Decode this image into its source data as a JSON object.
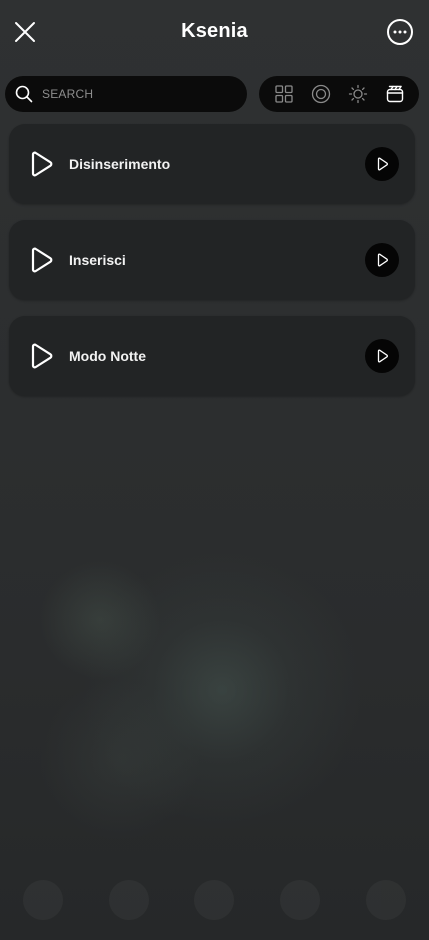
{
  "header": {
    "title": "Ksenia",
    "close_icon": "close-icon",
    "more_icon": "more-horizontal-icon"
  },
  "search": {
    "placeholder": "SEARCH",
    "value": "",
    "icon": "search-icon"
  },
  "filters": [
    {
      "name": "grid-filter",
      "icon": "grid-icon"
    },
    {
      "name": "target-filter",
      "icon": "target-icon"
    },
    {
      "name": "light-filter",
      "icon": "sun-icon"
    },
    {
      "name": "scenario-filter",
      "icon": "clapperboard-icon"
    }
  ],
  "scenarios": [
    {
      "label": "Disinserimento",
      "icon": "play-outline-icon",
      "action_icon": "play-icon"
    },
    {
      "label": "Inserisci",
      "icon": "play-outline-icon",
      "action_icon": "play-icon"
    },
    {
      "label": "Modo Notte",
      "icon": "play-outline-icon",
      "action_icon": "play-icon"
    }
  ],
  "colors": {
    "background": "#2b2d2e",
    "card": "#222425",
    "pill": "#0b0b0b",
    "text": "#ffffff",
    "placeholder": "#8d8d8d"
  }
}
